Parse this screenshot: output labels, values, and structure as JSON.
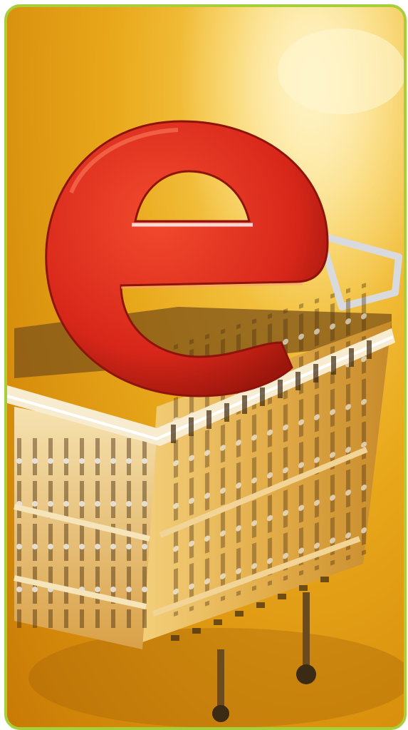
{
  "image": {
    "subject": "shopping-cart-with-letter-e",
    "letter": "e",
    "colors": {
      "border": "#a6cf3a",
      "background_light": "#ffe9a0",
      "background_mid": "#e9a91c",
      "background_dark": "#c87a06",
      "letter_red": "#d8271a",
      "letter_dark": "#a51a10",
      "cart_gold": "#e6b352",
      "cart_dark": "#8a5c1a"
    }
  }
}
